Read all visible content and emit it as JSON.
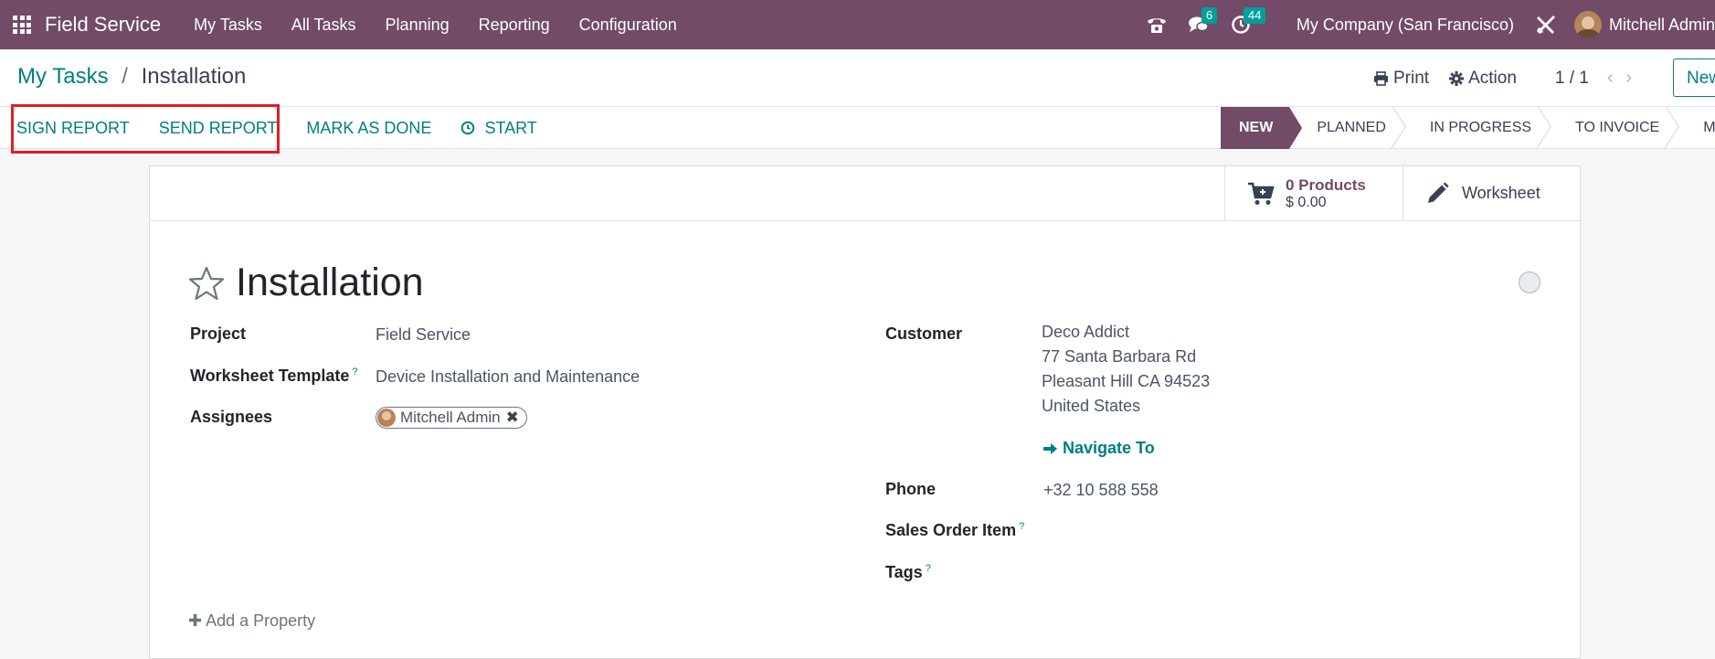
{
  "navbar": {
    "app_name": "Field Service",
    "menu": [
      "My Tasks",
      "All Tasks",
      "Planning",
      "Reporting",
      "Configuration"
    ],
    "messages_count": "6",
    "activities_count": "44",
    "company": "My Company (San Francisco)",
    "user": "Mitchell Admin"
  },
  "breadcrumb": {
    "parent": "My Tasks",
    "separator": "/",
    "current": "Installation"
  },
  "control": {
    "print_label": "Print",
    "action_label": "Action",
    "pager": "1 / 1",
    "new_label": "New"
  },
  "statusbar": {
    "actions": [
      "SIGN REPORT",
      "SEND REPORT",
      "MARK AS DONE",
      "START"
    ],
    "stages": [
      "NEW",
      "PLANNED",
      "IN PROGRESS",
      "TO INVOICE",
      "MORE"
    ],
    "active_stage": "NEW"
  },
  "buttons": {
    "products_value": "0 Products",
    "products_amount": "$ 0.00",
    "worksheet_label": "Worksheet"
  },
  "form": {
    "title": "Installation",
    "project_label": "Project",
    "project_value": "Field Service",
    "worksheet_template_label": "Worksheet Template",
    "worksheet_template_value": "Device Installation and Maintenance",
    "assignees_label": "Assignees",
    "assignee": "Mitchell Admin",
    "customer_label": "Customer",
    "customer_name": "Deco Addict",
    "customer_street": "77 Santa Barbara Rd",
    "customer_city": "Pleasant Hill CA 94523",
    "customer_country": "United States",
    "navigate_label": "Navigate To",
    "phone_label": "Phone",
    "phone_value": "+32 10 588 558",
    "sales_order_item_label": "Sales Order Item",
    "tags_label": "Tags",
    "help_mark": "?",
    "add_property": "Add a Property"
  },
  "colors": {
    "navbar": "#714b67",
    "link": "#017e84",
    "highlight": "#e31c23"
  }
}
